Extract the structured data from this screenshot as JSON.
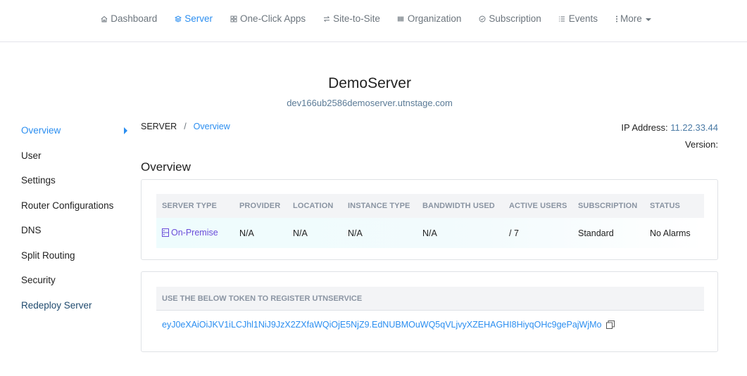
{
  "nav": {
    "items": [
      {
        "label": "Dashboard",
        "icon": "home-icon",
        "active": false
      },
      {
        "label": "Server",
        "icon": "layers-icon",
        "active": true
      },
      {
        "label": "One-Click Apps",
        "icon": "grid-icon",
        "active": false
      },
      {
        "label": "Site-to-Site",
        "icon": "swap-arrows-icon",
        "active": false
      },
      {
        "label": "Organization",
        "icon": "columns-icon",
        "active": false
      },
      {
        "label": "Subscription",
        "icon": "check-circle-icon",
        "active": false
      },
      {
        "label": "Events",
        "icon": "list-icon",
        "active": false
      },
      {
        "label": "More",
        "icon": "vertical-dots-icon",
        "active": false
      }
    ]
  },
  "server": {
    "name": "DemoServer",
    "hostname": "dev166ub2586demoserver.utnstage.com"
  },
  "sidebar": {
    "items": [
      {
        "label": "Overview",
        "active": true
      },
      {
        "label": "User"
      },
      {
        "label": "Settings"
      },
      {
        "label": "Router Configurations"
      },
      {
        "label": "DNS"
      },
      {
        "label": "Split Routing"
      },
      {
        "label": "Security"
      },
      {
        "label": "Redeploy Server"
      }
    ]
  },
  "breadcrumb": {
    "root": "SERVER",
    "separator": "/",
    "current": "Overview"
  },
  "meta": {
    "ip_label": "IP Address:",
    "ip_value": "11.22.33.44",
    "version_label": "Version:",
    "version_value": ""
  },
  "overview": {
    "title": "Overview",
    "columns": [
      "SERVER TYPE",
      "PROVIDER",
      "LOCATION",
      "INSTANCE TYPE",
      "BANDWIDTH USED",
      "ACTIVE USERS",
      "SUBSCRIPTION",
      "STATUS"
    ],
    "row": {
      "server_type": "On-Premise",
      "provider": "N/A",
      "location": "N/A",
      "instance_type": "N/A",
      "bandwidth_used": "N/A",
      "active_users": "/ 7",
      "subscription": "Standard",
      "status": "No Alarms"
    }
  },
  "token": {
    "heading": "USE THE BELOW TOKEN TO REGISTER UTNSERVICE",
    "value": "eyJ0eXAiOiJKV1iLCJhl1NiJ9JzX2ZXfaWQiOjE5NjZ9.EdNUBMOuWQ5qVLjvyXZEHAGHI8HiyqOHc9gePajWjMo"
  },
  "colors": {
    "accent": "#2b8ef0",
    "server_type": "#6a4bd9",
    "redeploy": "#1f4a6e",
    "header_bg": "#f3f4f6"
  }
}
